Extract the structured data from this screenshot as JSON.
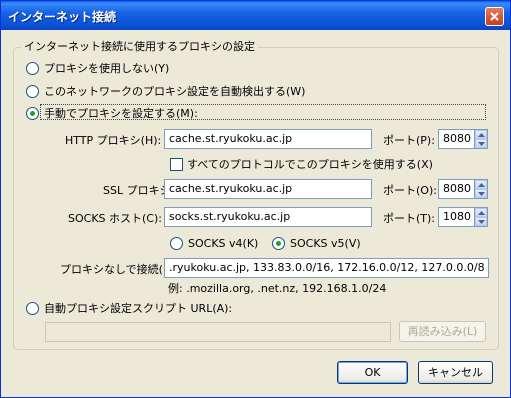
{
  "window": {
    "title": "インターネット接続",
    "close_icon": "close-icon"
  },
  "group": {
    "legend": "インターネット接続に使用するプロキシの設定"
  },
  "options": {
    "no_proxy": "プロキシを使用しない(Y)",
    "auto_detect": "このネットワークのプロキシ設定を自動検出する(W)",
    "manual": "手動でプロキシを設定する(M):",
    "auto_url": "自動プロキシ設定スクリプト URL(A):",
    "selected": "manual"
  },
  "http": {
    "label": "HTTP プロキシ(H):",
    "host": "cache.st.ryukoku.ac.jp",
    "port_label": "ポート(P):",
    "port": "8080"
  },
  "same_proxy": {
    "label": "すべてのプロトコルでこのプロキシを使用する(X)",
    "checked": false
  },
  "ssl": {
    "label": "SSL プロキシ(S):",
    "host": "cache.st.ryukoku.ac.jp",
    "port_label": "ポート(O):",
    "port": "8080"
  },
  "socks": {
    "label": "SOCKS ホスト(C):",
    "host": "socks.st.ryukoku.ac.jp",
    "port_label": "ポート(T):",
    "port": "1080",
    "v4": "SOCKS v4(K)",
    "v5": "SOCKS v5(V)",
    "version_selected": "v5"
  },
  "no_proxy_for": {
    "label": "プロキシなしで接続(N):",
    "value": ".ryukoku.ac.jp, 133.83.0.0/16, 172.16.0.0/12, 127.0.0.0/8",
    "example": "例: .mozilla.org, .net.nz, 192.168.1.0/24"
  },
  "auto_url": {
    "value": "",
    "reload_label": "再読み込み(L)"
  },
  "buttons": {
    "ok": "OK",
    "cancel": "キャンセル"
  },
  "colors": {
    "title_bar": "#0a52d6",
    "dialog_bg": "#ece9d8",
    "radio_dot": "#21a121"
  }
}
